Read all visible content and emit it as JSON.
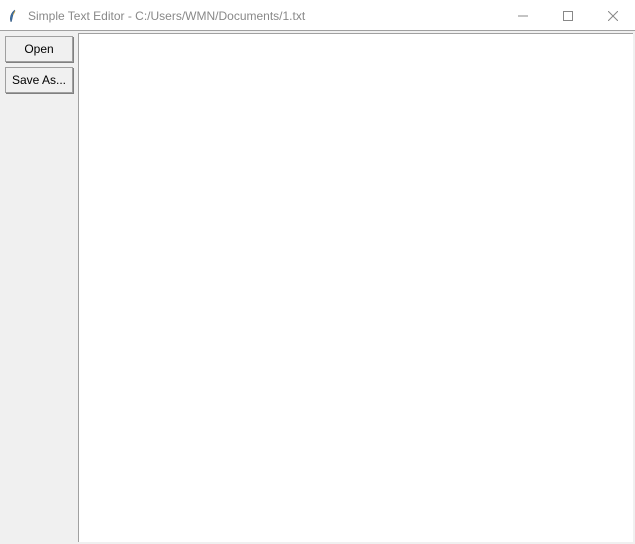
{
  "window": {
    "title": "Simple Text Editor - C:/Users/WMN/Documents/1.txt"
  },
  "sidebar": {
    "open_label": "Open",
    "saveas_label": "Save As..."
  },
  "editor": {
    "content": ""
  }
}
